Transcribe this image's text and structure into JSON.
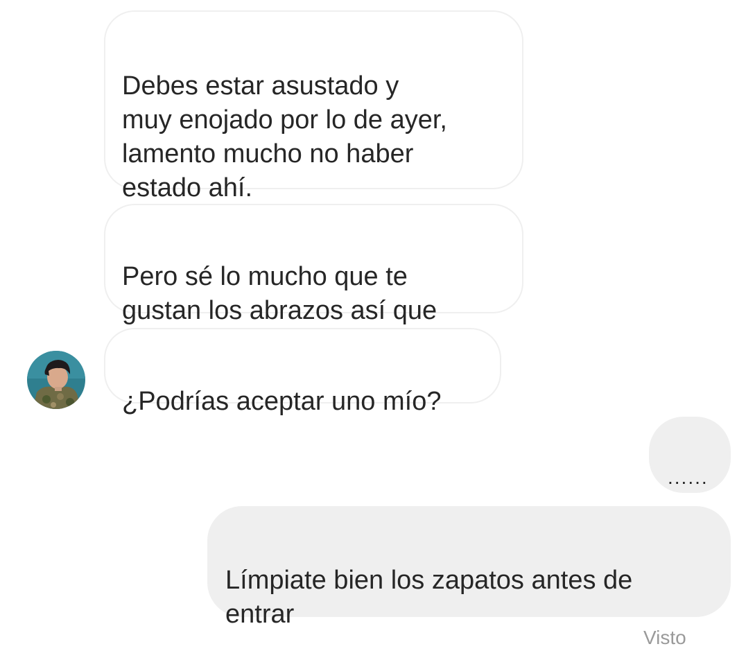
{
  "messages": [
    {
      "sender": "other",
      "text": "Debes estar asustado y\nmuy enojado por lo de ayer,\nlamento mucho no haber\nestado ahí."
    },
    {
      "sender": "other",
      "text": "Pero sé lo mucho que te\ngustan los abrazos así que"
    },
    {
      "sender": "other",
      "text": "¿Podrías aceptar uno mío?"
    },
    {
      "sender": "me",
      "text": "......"
    },
    {
      "sender": "me",
      "text": "Límpiate bien los zapatos antes de\nentrar"
    }
  ],
  "seen_status": "Visto",
  "colors": {
    "incoming_bubble_bg": "#ffffff",
    "incoming_bubble_border": "#efefef",
    "outgoing_bubble_bg": "#efefef",
    "text": "#262626",
    "seen_text": "#9a9a9a"
  }
}
